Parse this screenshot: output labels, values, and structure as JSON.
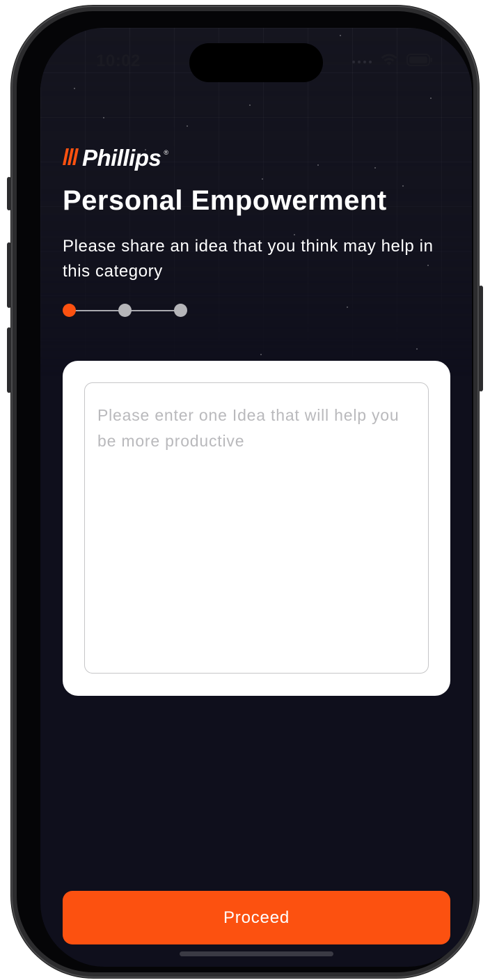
{
  "status_bar": {
    "time": "10:02",
    "wifi_icon": "wifi-icon",
    "battery_icon": "battery-icon"
  },
  "brand": {
    "logo_text": "Phillips",
    "registered_mark": "®",
    "accent_color": "#fc5110"
  },
  "header": {
    "title": "Personal Empowerment",
    "subtitle": "Please share an idea that you think may help in this category"
  },
  "progress": {
    "total_steps": 3,
    "current_step": 1,
    "active_color": "#fc5110",
    "inactive_color": "#b5b5b9"
  },
  "idea_input": {
    "value": "",
    "placeholder": "Please enter one Idea that will help you be more productive"
  },
  "actions": {
    "proceed_label": "Proceed"
  },
  "colors": {
    "background": "#0f0f1c",
    "card": "#ffffff",
    "button": "#fc5110"
  }
}
